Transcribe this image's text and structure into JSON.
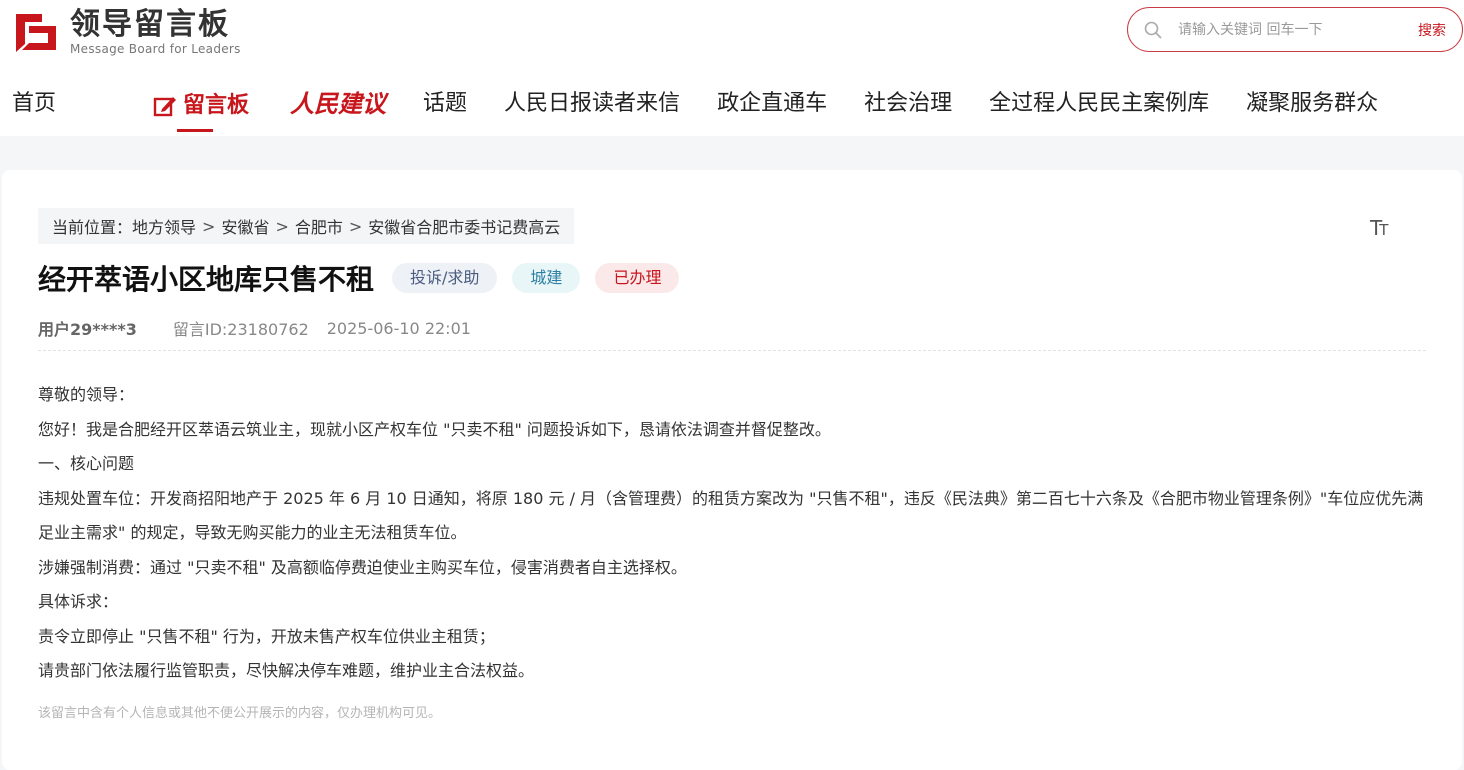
{
  "logo": {
    "title_cn": "领导留言板",
    "title_en": "Message Board for Leaders",
    "brand_color": "#c8161d"
  },
  "search": {
    "placeholder": "请输入关键词 回车一下",
    "button_label": "搜索"
  },
  "nav": {
    "items": [
      {
        "label": "首页"
      },
      {
        "label": "留言板"
      },
      {
        "label": "人民建议"
      },
      {
        "label": "话题"
      },
      {
        "label": "人民日报读者来信"
      },
      {
        "label": "政企直通车"
      },
      {
        "label": "社会治理"
      },
      {
        "label": "全过程人民民主案例库"
      },
      {
        "label": "凝聚服务群众"
      }
    ],
    "active_index": 1
  },
  "breadcrumb": {
    "prefix": "当前位置：",
    "items": [
      "地方领导",
      "安徽省",
      "合肥市",
      "安徽省合肥市委书记费高云"
    ],
    "separator": ">"
  },
  "font_size_icon": "text-size-icon",
  "post": {
    "title": "经开萃语小区地库只售不租",
    "tags": {
      "type": "投诉/求助",
      "domain": "城建",
      "status": "已办理"
    },
    "user": "用户29****3",
    "message_id": "留言ID:23180762",
    "datetime": "2025-06-10 22:01",
    "paragraphs": [
      "尊敬的领导：",
      "您好！我是合肥经开区萃语云筑业主，现就小区产权车位 \"只卖不租\" 问题投诉如下，恳请依法调查并督促整改。",
      "一、核心问题",
      "违规处置车位：开发商招阳地产于 2025 年 6 月 10 日通知，将原 180 元 / 月（含管理费）的租赁方案改为 \"只售不租\"，违反《民法典》第二百七十六条及《合肥市物业管理条例》\"车位应优先满足业主需求\" 的规定，导致无购买能力的业主无法租赁车位。",
      "涉嫌强制消费：通过 \"只卖不租\" 及高额临停费迫使业主购买车位，侵害消费者自主选择权。",
      "具体诉求：",
      "责令立即停止 \"只售不租\" 行为，开放未售产权车位供业主租赁；",
      "请贵部门依法履行监管职责，尽快解决停车难题，维护业主合法权益。"
    ],
    "privacy_notice": "该留言中含有个人信息或其他不便公开展示的内容，仅办理机构可见。"
  }
}
